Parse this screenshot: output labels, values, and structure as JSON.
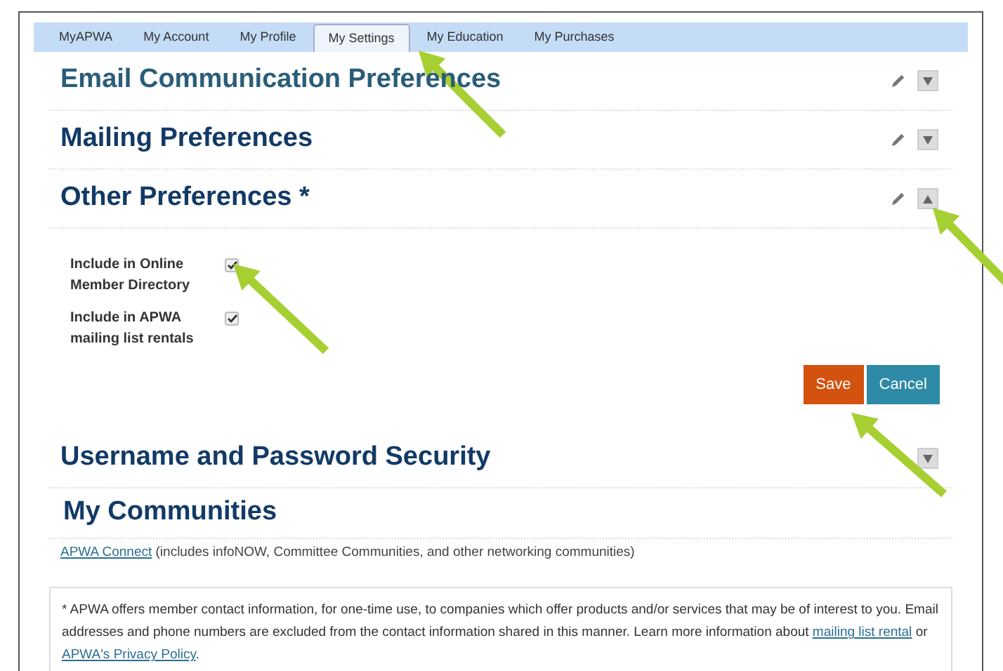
{
  "tabs": [
    {
      "label": "MyAPWA",
      "selected": false
    },
    {
      "label": "My Account",
      "selected": false
    },
    {
      "label": "My Profile",
      "selected": false
    },
    {
      "label": "My Settings",
      "selected": true
    },
    {
      "label": "My Education",
      "selected": false
    },
    {
      "label": "My Purchases",
      "selected": false
    }
  ],
  "sections": [
    {
      "title": "Email Communication Preferences",
      "editable": true,
      "expanded": false
    },
    {
      "title": "Mailing Preferences",
      "editable": true,
      "expanded": false
    },
    {
      "title": "Other Preferences *",
      "editable": true,
      "expanded": true,
      "options": [
        {
          "label": "Include in Online Member Directory",
          "checked": true
        },
        {
          "label": "Include in APWA mailing list rentals",
          "checked": true
        }
      ],
      "buttons": [
        {
          "label": "Save",
          "kind": "primary"
        },
        {
          "label": "Cancel",
          "kind": "secondary"
        }
      ]
    },
    {
      "title": "Username and Password Security",
      "editable": false,
      "expanded": false
    }
  ],
  "communities": {
    "title": "My Communities",
    "link": "APWA Connect",
    "text": "(includes infoNOW, Committee Communities, and other networking communities)"
  },
  "footnote": {
    "text_1": "* APWA offers member contact information, for one-time use, to companies which offer products and/or services that may be of interest to you. Email addresses and phone numbers are excluded from the contact information shared in this manner. Learn more information about",
    "link_1": "mailing list rental",
    "text_2": "or",
    "link_2": "APWA's Privacy Policy",
    "text_3": "."
  }
}
